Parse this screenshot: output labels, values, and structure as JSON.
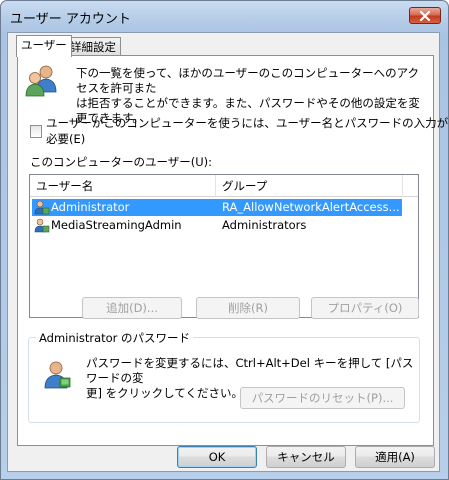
{
  "window": {
    "title": "ユーザー アカウント"
  },
  "tabs": [
    {
      "label": "ユーザー",
      "active": true
    },
    {
      "label": "詳細設定",
      "active": false
    }
  ],
  "intro": {
    "text_line1": "下の一覧を使って、ほかのユーザーのこのコンピューターへのアクセスを許可また",
    "text_line2": "は拒否することができます。また、パスワードやその他の設定を変更できます。"
  },
  "require_login": {
    "label": "ユーザーがこのコンピューターを使うには、ユーザー名とパスワードの入力が必要(E)",
    "checked": false
  },
  "users": {
    "label": "このコンピューターのユーザー(U):",
    "columns": [
      "ユーザー名",
      "グループ"
    ],
    "rows": [
      {
        "name": "Administrator",
        "group": "RA_AllowNetworkAlertAccess...",
        "selected": true
      },
      {
        "name": "MediaStreamingAdmin",
        "group": "Administrators",
        "selected": false
      }
    ],
    "buttons": {
      "add": "追加(D)...",
      "remove": "削除(R)",
      "properties": "プロパティ(O)"
    }
  },
  "password": {
    "group_title": "Administrator のパスワード",
    "text_line1": "パスワードを変更するには、Ctrl+Alt+Del キーを押して [パスワードの変",
    "text_line2": "更] をクリックしてください。",
    "reset_button": "パスワードのリセット(P)..."
  },
  "footer": {
    "ok": "OK",
    "cancel": "キャンセル",
    "apply": "適用(A)"
  },
  "colors": {
    "selection": "#3399ff",
    "close_button": "#c23b1f",
    "window_frame": "#b6cde8"
  }
}
